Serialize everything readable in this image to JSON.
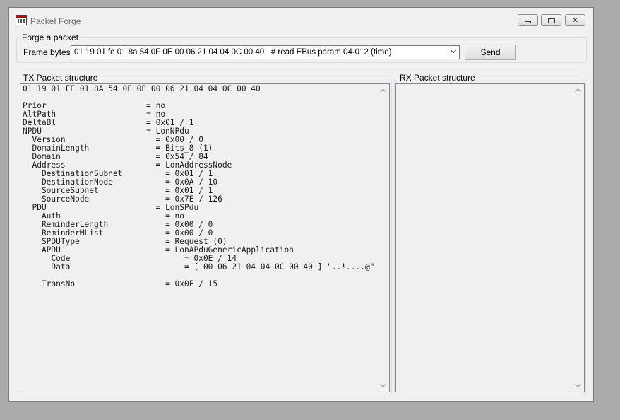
{
  "window": {
    "title": "Packet Forge"
  },
  "forge": {
    "legend": "Forge a packet",
    "frame_label": "Frame bytes",
    "frame_value": "01 19 01 fe 01 8a 54 0F 0E 00 06 21 04 04 0C 00 40   # read EBus param 04-012 (time)",
    "send_label": "Send"
  },
  "tx": {
    "legend": "TX Packet structure",
    "lines": [
      "01 19 01 FE 01 8A 54 0F 0E 00 06 21 04 04 0C 00 40",
      "",
      "Prior                     = no",
      "AltPath                   = no",
      "DeltaBl                   = 0x01 / 1",
      "NPDU                      = LonNPdu",
      "  Version                   = 0x00 / 0",
      "  DomainLength              = Bits_8 (1)",
      "  Domain                    = 0x54 / 84",
      "  Address                   = LonAddressNode",
      "    DestinationSubnet         = 0x01 / 1",
      "    DestinationNode           = 0x0A / 10",
      "    SourceSubnet              = 0x01 / 1",
      "    SourceNode                = 0x7E / 126",
      "  PDU                       = LonSPdu",
      "    Auth                      = no",
      "    ReminderLength            = 0x00 / 0",
      "    ReminderMList             = 0x00 / 0",
      "    SPDUType                  = Request (0)",
      "    APDU                      = LonAPduGenericApplication",
      "      Code                        = 0x0E / 14",
      "      Data                        = [ 00 06 21 04 04 0C 00 40 ] \"..!....@\"",
      "",
      "    TransNo                   = 0x0F / 15"
    ]
  },
  "rx": {
    "legend": "RX Packet structure"
  }
}
